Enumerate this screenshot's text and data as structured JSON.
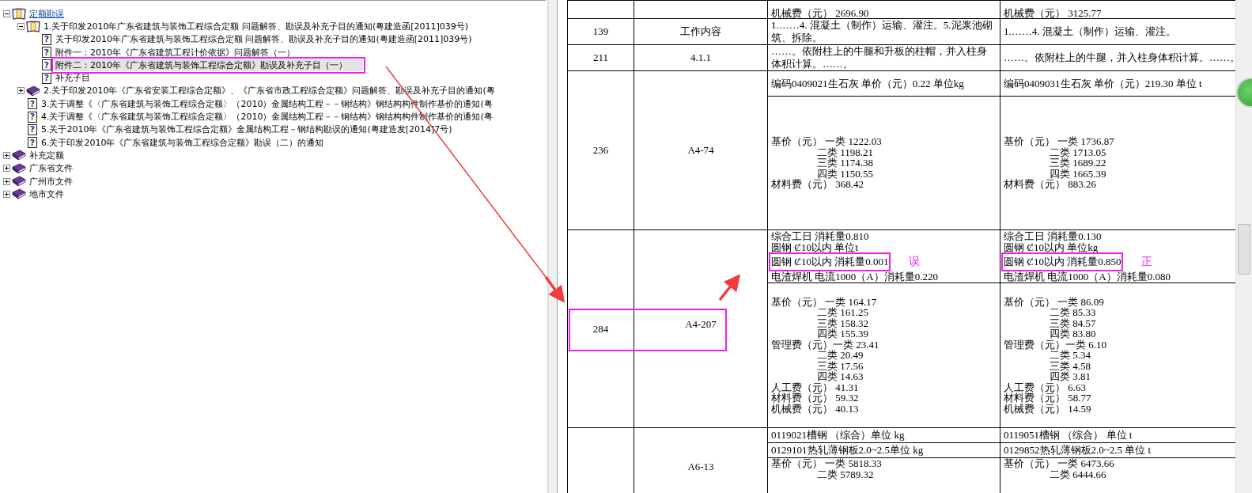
{
  "tree": [
    {
      "label": "定额勘误",
      "kind": "open-book",
      "link": true,
      "expanded": true,
      "selected": false,
      "children": [
        {
          "label": "1.关于印发2010年广东省建筑与装饰工程综合定额 问题解答、勘误及补充子目的通知(粤建造函[2011]039号)",
          "kind": "open-book",
          "expanded": true,
          "selected": false,
          "children": [
            {
              "label": "关于印发2010年广东省建筑与装饰工程综合定额 问题解答、勘误及补充子目的通知(粤建造函[2011]039号)",
              "kind": "doc",
              "icon": "?",
              "selected": false,
              "highlighted": false
            },
            {
              "label": "附件一：2010年《广东省建筑工程计价依据》问题解答（一）",
              "kind": "doc",
              "icon": "?",
              "selected": false,
              "highlighted": false
            },
            {
              "label": "附件二：2010年《广东省建筑与装饰工程综合定额》勘误及补充子目（一）",
              "kind": "doc",
              "icon": "?",
              "selected": true,
              "highlighted": true
            },
            {
              "label": "补充子目",
              "kind": "doc",
              "icon": "?",
              "selected": false,
              "highlighted": false
            }
          ]
        },
        {
          "label": "2.关于印发2010年《广东省安装工程综合定额》、《广东省市政工程综合定额》问题解答、勘误及补充子目的通知(粤",
          "kind": "book",
          "expanded": false,
          "selected": false
        },
        {
          "label": "3.关于调整《〈广东省建筑与装饰工程综合定额〉（2010）金属结构工程－－钢结构》钢结构构件制作基价的通知(粤",
          "kind": "doc",
          "icon": "?",
          "selected": false
        },
        {
          "label": "4.关于调整《〈广东省建筑与装饰工程综合定额〉（2010）金属结构工程－－钢结构》钢结构构件制作基价的通知(粤",
          "kind": "doc",
          "icon": "?",
          "selected": false
        },
        {
          "label": "5.关于2010年《广东省建筑与装饰工程综合定额》金属结构工程－钢结构勘误的通知(粤建造发[2014]7号)",
          "kind": "doc",
          "icon": "?",
          "selected": false
        },
        {
          "label": "6.关于印发2010年《广东省建筑与装饰工程综合定额》勘误（二）的通知",
          "kind": "doc",
          "icon": "?",
          "selected": false
        }
      ]
    },
    {
      "label": "补充定额",
      "kind": "book",
      "expanded": false,
      "selected": false
    },
    {
      "label": "广东省文件",
      "kind": "book",
      "expanded": false,
      "selected": false
    },
    {
      "label": "广州市文件",
      "kind": "book",
      "expanded": false,
      "selected": false
    },
    {
      "label": "地市文件",
      "kind": "book",
      "expanded": false,
      "selected": false
    }
  ],
  "table": {
    "rows": [
      {
        "column_3": [
          [
            {
              "kind": "head",
              "text": "机械费（元）   2696.90"
            }
          ]
        ],
        "column_4": [
          [
            {
              "kind": "head",
              "text": "机械费（元）   3125.77"
            }
          ]
        ]
      },
      {
        "column_1": "139",
        "column_2": "工作内容",
        "column_3": [
          [
            {
              "kind": "text",
              "text": "1.……4. 混凝土（制作）运输、灌注。5.泥浆池砌筑、拆除。"
            }
          ]
        ],
        "column_4": [
          [
            {
              "kind": "text",
              "text": "1.……4. 混凝土（制作）运输、灌注。"
            }
          ]
        ]
      },
      {
        "column_1": "211",
        "column_2": "4.1.1",
        "column_3": [
          [
            {
              "kind": "text",
              "text": "……。依附柱上的牛腿和升板的柱帽，并入柱身体积计算。……。"
            }
          ]
        ],
        "column_4": [
          [
            {
              "kind": "text",
              "text": "……。依附柱上的牛腿，并入柱身体积计算。……。"
            }
          ]
        ]
      },
      {
        "column_1": "236",
        "column_2": "A4-74",
        "column_3": [
          [
            {
              "kind": "text",
              "text": "编码0409021生石灰 单价（元）0.22 单位kg"
            }
          ],
          [
            {
              "kind": "head",
              "text": "基价（元） 一类 1222.03"
            },
            {
              "kind": "sub",
              "text": "二类 1198.21"
            },
            {
              "kind": "sub",
              "text": "三类 1174.38"
            },
            {
              "kind": "sub",
              "text": "四类 1150.55"
            },
            {
              "kind": "head",
              "text": "材料费（元）   368.42"
            }
          ]
        ],
        "column_4": [
          [
            {
              "kind": "text",
              "text": "编码0409031生石灰 单价（元）219.30 单位 t"
            }
          ],
          [
            {
              "kind": "head",
              "text": "基价（元） 一类 1736.87"
            },
            {
              "kind": "sub",
              "text": "二类 1713.05"
            },
            {
              "kind": "sub",
              "text": "三类 1689.22"
            },
            {
              "kind": "sub",
              "text": "四类 1665.39"
            },
            {
              "kind": "head",
              "text": "材料费（元）   883.26"
            }
          ]
        ]
      },
      {
        "column_1": "284",
        "column_2": "A4-207",
        "highlighted": true,
        "column_3": [
          [
            {
              "kind": "head",
              "text": "综合工日  消耗量0.810"
            },
            {
              "kind": "head",
              "text": "圆钢 Ȼ10以内 单位t"
            },
            {
              "kind": "head",
              "text": "圆钢 Ȼ10以内 消耗量0.001",
              "highlighted": true,
              "note": "误"
            },
            {
              "kind": "head",
              "text": "电渣焊机 电流1000（A）消耗量0.220"
            }
          ],
          [
            {
              "kind": "head",
              "text": "基价（元）  一类 164.17"
            },
            {
              "kind": "sub",
              "text": "二类 161.25"
            },
            {
              "kind": "sub",
              "text": "三类 158.32"
            },
            {
              "kind": "sub",
              "text": "四类 155.39"
            },
            {
              "kind": "head",
              "text": "管理费（元）一类 23.41"
            },
            {
              "kind": "sub",
              "text": "二类 20.49"
            },
            {
              "kind": "sub",
              "text": "三类 17.56"
            },
            {
              "kind": "sub",
              "text": "四类 14.63"
            },
            {
              "kind": "head",
              "text": "人工费（元）    41.31"
            },
            {
              "kind": "head",
              "text": "材料费（元）    59.32"
            },
            {
              "kind": "head",
              "text": "机械费（元）    40.13"
            }
          ]
        ],
        "column_4": [
          [
            {
              "kind": "head",
              "text": "综合工日  消耗量0.130"
            },
            {
              "kind": "head",
              "text": "圆钢 Ȼ10以内 单位kg"
            },
            {
              "kind": "head",
              "text": "圆钢 Ȼ10以内 消耗量0.850",
              "highlighted": true,
              "note": "正"
            },
            {
              "kind": "head",
              "text": "电渣焊机 电流1000（A）消耗量0.080"
            }
          ],
          [
            {
              "kind": "head",
              "text": "基价（元）  一类 86.09"
            },
            {
              "kind": "sub",
              "text": "二类 85.33"
            },
            {
              "kind": "sub",
              "text": "三类 84.57"
            },
            {
              "kind": "sub",
              "text": "四类 83.80"
            },
            {
              "kind": "head",
              "text": "管理费（元）一类 6.10"
            },
            {
              "kind": "sub",
              "text": "二类 5.34"
            },
            {
              "kind": "sub",
              "text": "三类 4.58"
            },
            {
              "kind": "sub",
              "text": "四类 3.81"
            },
            {
              "kind": "head",
              "text": "人工费（元）    6.63"
            },
            {
              "kind": "head",
              "text": "材料费（元）    58.77"
            },
            {
              "kind": "head",
              "text": "机械费（元）    14.59"
            }
          ]
        ]
      },
      {
        "column_2": "A6-13",
        "column_3": [
          [
            {
              "kind": "head",
              "text": "0119021槽钢 （综合）单位 kg"
            }
          ],
          [
            {
              "kind": "head",
              "text": "0129101热轧薄钢板2.0~2.5单位 kg"
            }
          ],
          [
            {
              "kind": "head",
              "text": "基价（元） 一类 5818.33"
            },
            {
              "kind": "sub",
              "text": "二类 5789.32"
            }
          ]
        ],
        "column_4": [
          [
            {
              "kind": "head",
              "text": "0119051槽钢 （综合） 单位 t"
            }
          ],
          [
            {
              "kind": "head",
              "text": "0129852热轧薄钢板2.0~2.5 单位 t"
            }
          ],
          [
            {
              "kind": "head",
              "text": "基价（元） 一类 6473.66"
            },
            {
              "kind": "sub",
              "text": "二类 6444.66"
            }
          ]
        ]
      }
    ]
  }
}
